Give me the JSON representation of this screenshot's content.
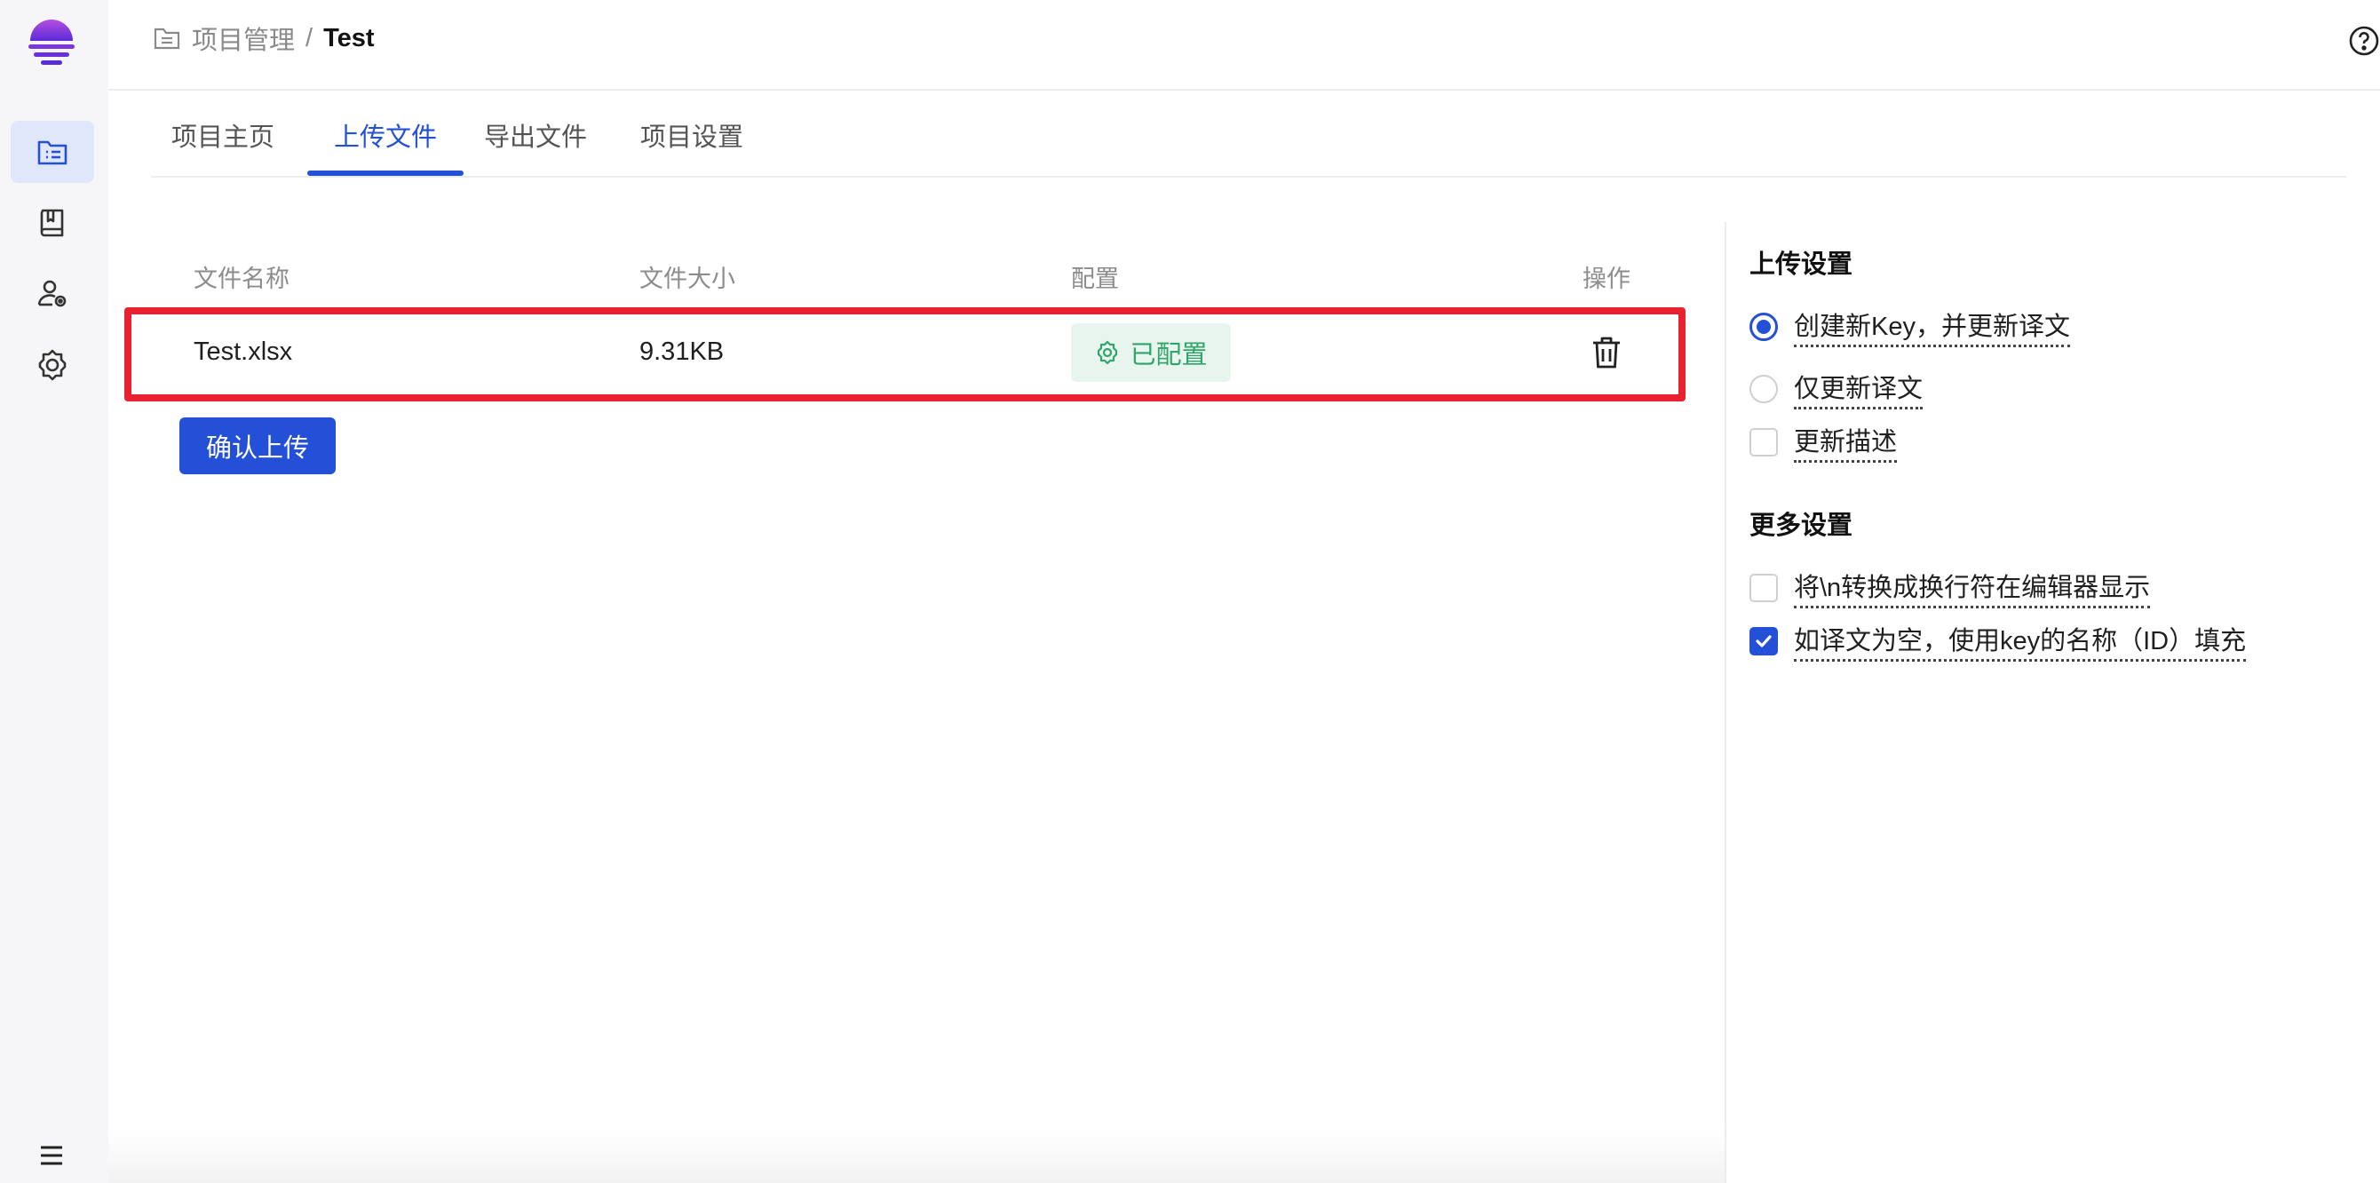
{
  "header": {
    "breadcrumb_parent": "项目管理",
    "breadcrumb_separator": "/",
    "breadcrumb_current": "Test"
  },
  "tabs": [
    {
      "label": "项目主页"
    },
    {
      "label": "上传文件"
    },
    {
      "label": "导出文件"
    },
    {
      "label": "项目设置"
    }
  ],
  "table": {
    "columns": [
      "文件名称",
      "文件大小",
      "配置",
      "操作"
    ],
    "rows": [
      {
        "name": "Test.xlsx",
        "size": "9.31KB",
        "config": "已配置"
      }
    ],
    "confirm_label": "确认上传"
  },
  "upload_settings": {
    "title": "上传设置",
    "options": [
      {
        "label": "创建新Key，并更新译文",
        "type": "radio",
        "checked": true
      },
      {
        "label": "仅更新译文",
        "type": "radio",
        "checked": false
      },
      {
        "label": "更新描述",
        "type": "checkbox",
        "checked": false
      }
    ]
  },
  "more_settings": {
    "title": "更多设置",
    "options": [
      {
        "label": "将\\n转换成换行符在编辑器显示",
        "type": "checkbox",
        "checked": false
      },
      {
        "label": "如译文为空，使用key的名称（ID）填充",
        "type": "checkbox",
        "checked": true
      }
    ]
  },
  "colors": {
    "accent": "#2350d6",
    "highlight_border": "#e8232f",
    "badge_bg": "#e7f5ee",
    "badge_text": "#31a46a"
  },
  "icons": {
    "sidebar": [
      "project-list-icon",
      "book-icon",
      "user-settings-icon",
      "gear-icon"
    ],
    "menu": "menu-icon",
    "help": "help-icon",
    "trash": "trash-icon",
    "config": "config-gear-icon"
  }
}
